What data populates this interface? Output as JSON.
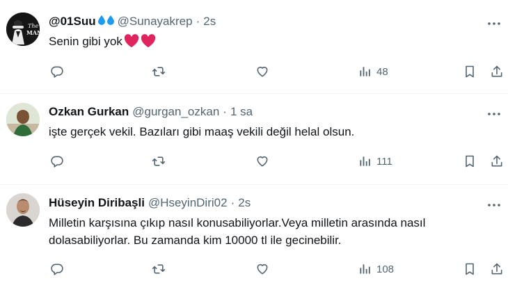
{
  "tweets": [
    {
      "name": "@01Suu",
      "handle": "@Sunayakrep",
      "time": "2s",
      "text": "Senin gibi yok",
      "text_lines": [
        "Senin gibi yok"
      ],
      "views": "48",
      "avatar_text": "The MAN",
      "decorations": [
        "water-drop-icon",
        "water-drop-icon"
      ],
      "text_emoji": [
        "red-heart-icon",
        "red-heart-icon"
      ]
    },
    {
      "name": "Ozkan Gurkan",
      "handle": "@gurgan_ozkan",
      "time": "1 sa",
      "text_lines": [
        "işte gerçek vekil. Bazıları gibi maaş vekili değil helal olsun."
      ],
      "views": "111"
    },
    {
      "name": "Hüseyin Diribaşli",
      "handle": "@HseyinDiri02",
      "time": "2s",
      "text_lines": [
        "Milletin karşısına çıkıp nasıl konusabiliyorlar.Veya milletin arasında nasıl",
        "dolasabiliyorlar. Bu zamanda kim 10000 tl ile gecinebilir."
      ],
      "views": "108"
    }
  ],
  "separator": "·",
  "colors": {
    "text": "#0f1419",
    "secondary": "#536471",
    "divider": "#eff3f4",
    "drop": "#1d9bf0",
    "heart": "#e0245e"
  },
  "icons": {
    "reply": "reply-icon",
    "retweet": "retweet-icon",
    "like": "like-icon",
    "views": "views-icon",
    "bookmark": "bookmark-icon",
    "share": "share-icon",
    "more": "more-icon"
  }
}
